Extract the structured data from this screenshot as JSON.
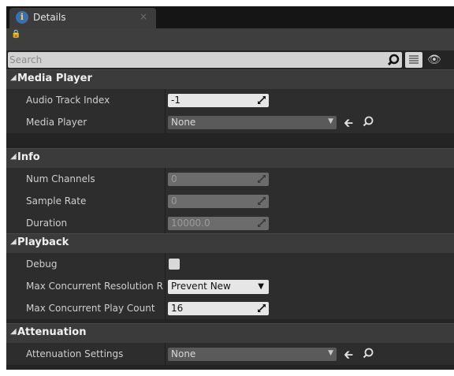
{
  "tab": {
    "title": "Details",
    "close": "×",
    "icon": "info-icon"
  },
  "search": {
    "placeholder": "Search"
  },
  "categories": [
    {
      "label": "Media Player",
      "rows": [
        {
          "label": "Audio Track Index",
          "value": "-1",
          "kind": "number"
        },
        {
          "label": "Media Player",
          "value": "None",
          "kind": "asset"
        }
      ]
    },
    {
      "label": "Info",
      "rows": [
        {
          "label": "Num Channels",
          "value": "0",
          "kind": "number-disabled"
        },
        {
          "label": "Sample Rate",
          "value": "0",
          "kind": "number-disabled"
        },
        {
          "label": "Duration",
          "value": "10000.0",
          "kind": "number-disabled"
        }
      ]
    },
    {
      "label": "Playback",
      "rows": [
        {
          "label": "Debug",
          "value": "",
          "kind": "checkbox"
        },
        {
          "label": "Max Concurrent Resolution R",
          "value": "Prevent New",
          "kind": "enum"
        },
        {
          "label": "Max Concurrent Play Count",
          "value": "16",
          "kind": "number"
        }
      ]
    },
    {
      "label": "Attenuation",
      "rows": [
        {
          "label": "Attenuation Settings",
          "value": "None",
          "kind": "asset"
        }
      ]
    }
  ],
  "colors": {
    "panel": "#242424",
    "row": "#2d2d2d",
    "category": "#3b3b3b",
    "field": "#e6e6e6"
  }
}
